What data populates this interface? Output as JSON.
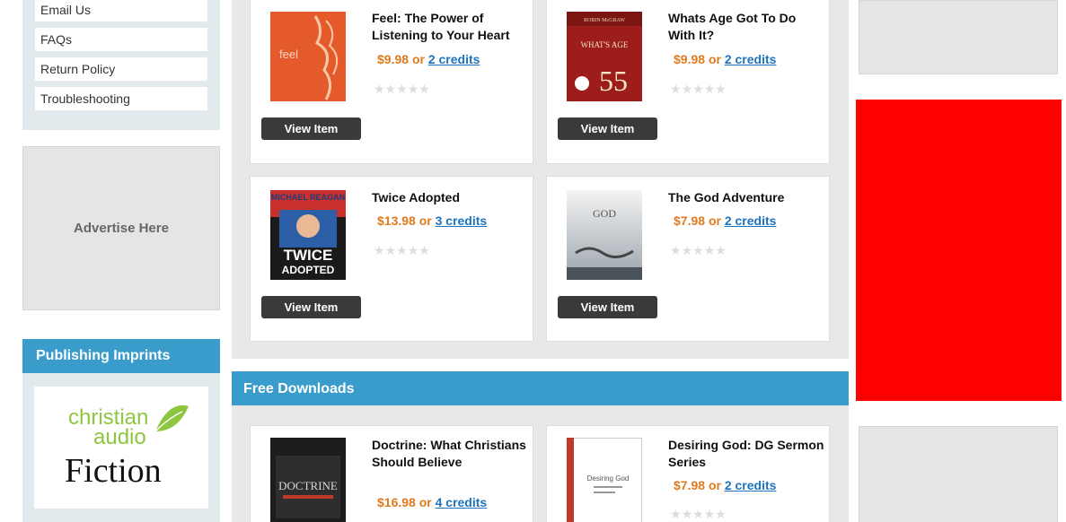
{
  "sidebar": {
    "help_links": [
      "Email Us",
      "FAQs",
      "Return Policy",
      "Troubleshooting"
    ],
    "ad_text": "Advertise Here",
    "imprints_heading": "Publishing Imprints",
    "imprint_logo": {
      "line1": "christian",
      "line2": "audio",
      "line3": "Fiction"
    }
  },
  "products": [
    {
      "title": "Feel: The Power of Listening to Your Heart",
      "price": "$9.98",
      "or": "or",
      "credits": "2 credits",
      "view": "View Item",
      "rating": 0
    },
    {
      "title": "Whats Age Got To Do With It?",
      "price": "$9.98",
      "or": "or",
      "credits": "2 credits",
      "view": "View Item",
      "rating": 0
    },
    {
      "title": "Twice Adopted",
      "price": "$13.98",
      "or": "or",
      "credits": "3 credits",
      "view": "View Item",
      "rating": 0
    },
    {
      "title": "The God Adventure",
      "price": "$7.98",
      "or": "or",
      "credits": "2 credits",
      "view": "View Item",
      "rating": 0
    }
  ],
  "free_downloads": {
    "heading": "Free Downloads",
    "items": [
      {
        "title": "Doctrine: What Christians Should Believe",
        "price": "$16.98",
        "or": "or",
        "credits": "4 credits"
      },
      {
        "title": "Desiring God: DG Sermon Series",
        "price": "$7.98",
        "or": "or",
        "credits": "2 credits",
        "rating": 0
      }
    ]
  },
  "covers": {
    "feel": {
      "word": "feel"
    },
    "age": {
      "author": "ROBIN McGRAW",
      "title": "WHAT'S AGE",
      "number": "55"
    },
    "twice": {
      "author": "MICHAEL REAGAN",
      "title1": "TWICE",
      "title2": "ADOPTED"
    },
    "god": {
      "title": "GOD"
    },
    "doctrine": {
      "title": "DOCTRINE"
    },
    "desiring": {
      "title": "Desiring God"
    }
  },
  "colors": {
    "accent_blue": "#3a9ccb",
    "price_orange": "#e07a1f",
    "link_blue": "#1e73be",
    "ad_red": "#ff0000"
  },
  "icons": {
    "star": "star-icon",
    "leaf": "leaf-icon"
  }
}
